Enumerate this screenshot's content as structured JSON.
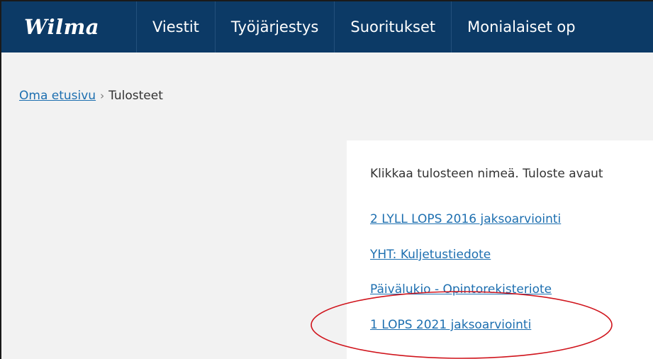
{
  "app": {
    "logo_text": "Wilma",
    "nav": [
      "Viestit",
      "Työjärjestys",
      "Suoritukset",
      "Monialaiset op"
    ]
  },
  "breadcrumb": {
    "home": "Oma etusivu",
    "separator": "›",
    "current": "Tulosteet"
  },
  "content": {
    "intro": "Klikkaa tulosteen nimeä. Tuloste avaut",
    "links": [
      "2 LYLL LOPS 2016 jaksoarviointi",
      "YHT: Kuljetustiedote",
      "Päivälukio - Opintorekisteriote",
      "1 LOPS 2021 jaksoarviointi"
    ]
  },
  "colors": {
    "topbar": "#0c3a66",
    "link": "#1d6fb0",
    "annotation": "#d0141c",
    "background": "#f2f2f2"
  }
}
